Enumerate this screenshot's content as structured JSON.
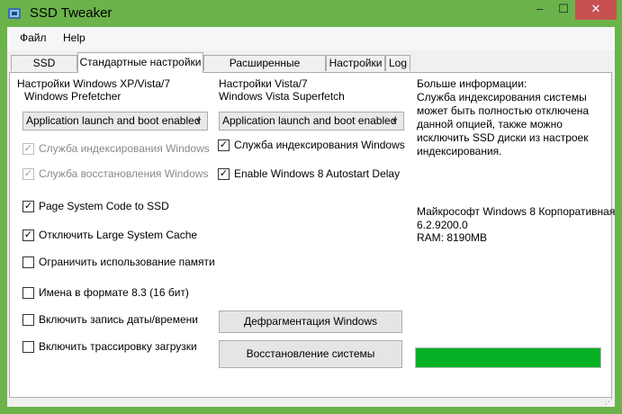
{
  "window": {
    "title": "SSD Tweaker",
    "minimize": "‒",
    "maximize": "☐",
    "close": "✕",
    "frame_color": "#6bb34a"
  },
  "menu": [
    "Файл",
    "Help"
  ],
  "tabs": [
    {
      "label": "SSD Tweaker",
      "active": false
    },
    {
      "label": "Стандартные настройки",
      "active": true
    },
    {
      "label": "Расширенные настройки",
      "active": false
    },
    {
      "label": "Настройки",
      "active": false
    },
    {
      "label": "Log",
      "active": false
    }
  ],
  "left": {
    "group_title": "Настройки Windows XP/Vista/7",
    "subtitle": "Windows Prefetcher",
    "combo_value": "Application launch and boot enabled",
    "checkboxes": [
      {
        "label": "Служба индексирования Windows",
        "checked": true,
        "disabled": true
      },
      {
        "label": "Служба восстановления Windows",
        "checked": true,
        "disabled": true
      },
      {
        "label": "Page System Code to SSD",
        "checked": true,
        "disabled": false
      },
      {
        "label": "Отключить Large System Cache",
        "checked": true,
        "disabled": false
      },
      {
        "label": "Ограничить использование памяти",
        "checked": false,
        "disabled": false
      },
      {
        "label": "Имена в формате 8.3 (16 бит)",
        "checked": false,
        "disabled": false
      },
      {
        "label": "Включить запись даты/времени",
        "checked": false,
        "disabled": false
      },
      {
        "label": "Включить трассировку загрузки",
        "checked": false,
        "disabled": false
      }
    ]
  },
  "middle": {
    "group_title": "Настройки Vista/7",
    "subtitle": "Windows Vista Superfetch",
    "combo_value": "Application launch and boot enabled",
    "checkboxes": [
      {
        "label": "Служба индексирования Windows",
        "checked": true,
        "disabled": false
      },
      {
        "label": "Enable Windows 8 Autostart Delay",
        "checked": true,
        "disabled": false
      }
    ],
    "defrag_button": "Дефрагментация Windows",
    "restore_button": "Восстановление системы"
  },
  "right": {
    "info_title": "Больше информации:",
    "info_text": [
      "Служба индексирования системы",
      "может быть полностью отключена",
      "данной опцией, также можно",
      "исключить SSD диски из настроек",
      "индексирования."
    ],
    "system_info": [
      "Майкрософт Windows 8 Корпоративная",
      "6.2.9200.0",
      "RAM: 8190MB"
    ],
    "progress": 1.0,
    "progress_color": "#06b025"
  },
  "status_grip": "⋰"
}
